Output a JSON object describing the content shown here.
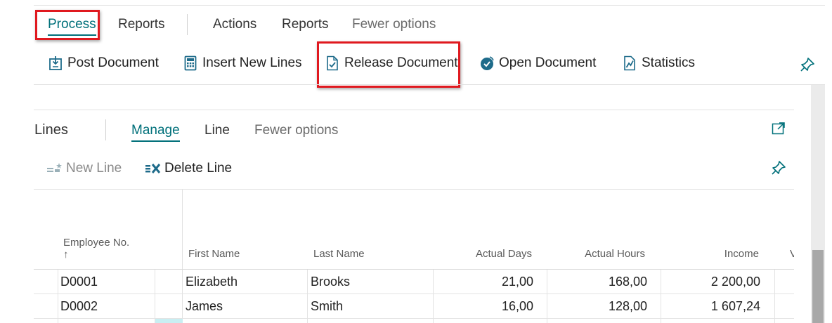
{
  "top_tabs": {
    "process": "Process",
    "reports": "Reports",
    "actions": "Actions",
    "reports2": "Reports",
    "fewer_options": "Fewer options"
  },
  "actions": {
    "post_document": "Post Document",
    "insert_new_lines": "Insert New Lines",
    "release_document": "Release Document",
    "open_document": "Open Document",
    "statistics": "Statistics"
  },
  "lines": {
    "title": "Lines",
    "tabs": {
      "manage": "Manage",
      "line": "Line",
      "fewer_options": "Fewer options"
    },
    "actions": {
      "new_line": "New Line",
      "delete_line": "Delete Line"
    },
    "columns": {
      "employee_no": "Employee No.",
      "sort_indicator": "↑",
      "first_name": "First Name",
      "last_name": "Last Name",
      "actual_days": "Actual Days",
      "actual_hours": "Actual Hours",
      "income": "Income",
      "truncated": "V"
    },
    "rows": [
      {
        "employee_no": "D0001",
        "first_name": "Elizabeth",
        "last_name": "Brooks",
        "actual_days": "21,00",
        "actual_hours": "168,00",
        "income": "2 200,00"
      },
      {
        "employee_no": "D0002",
        "first_name": "James",
        "last_name": "Smith",
        "actual_days": "16,00",
        "actual_hours": "128,00",
        "income": "1 607,24"
      }
    ]
  },
  "icons": {
    "post_document": "post-document-icon",
    "insert_new_lines": "calculator-icon",
    "release_document": "release-document-icon",
    "open_document": "open-document-icon",
    "statistics": "statistics-icon",
    "pin": "pin-icon",
    "new_line": "new-line-icon",
    "delete_line": "delete-line-icon",
    "expand": "expand-icon"
  },
  "colors": {
    "accent": "#00707a",
    "highlight_box": "#e0191f",
    "text": "#212121",
    "muted_text": "#6b6b6b"
  }
}
